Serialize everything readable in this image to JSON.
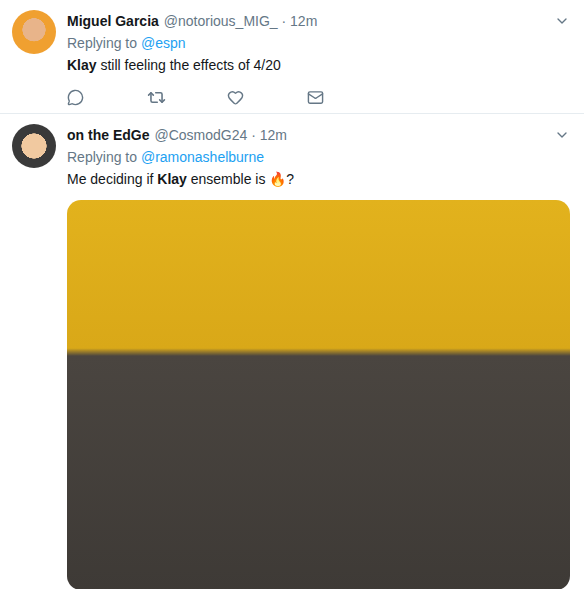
{
  "tweets": [
    {
      "name": "Miguel Garcia",
      "meta": "@notorious_MIG_ · 12m",
      "replying_label": "Replying to",
      "replying_to": "@espn",
      "text": [
        {
          "text": "Klay",
          "bold": true
        },
        {
          "text": " still feeling the effects of 4/20",
          "bold": false
        }
      ],
      "actions_shown": true,
      "media": null
    },
    {
      "name": "on the EdGe",
      "meta": "@CosmodG24 · 12m",
      "replying_label": "Replying to",
      "replying_to": "@ramonashelburne",
      "text": [
        {
          "text": "Me deciding if ",
          "bold": false
        },
        {
          "text": "Klay",
          "bold": true
        },
        {
          "text": " ensemble is 🔥?",
          "bold": false
        }
      ],
      "actions_shown": false,
      "media": {
        "kind": "photo"
      }
    }
  ]
}
